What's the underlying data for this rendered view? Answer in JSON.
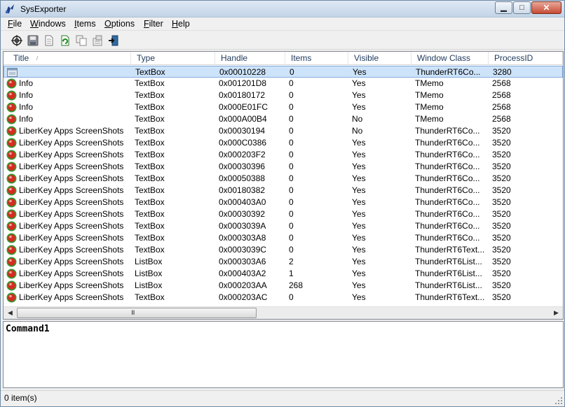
{
  "app": {
    "title": "SysExporter"
  },
  "caption": {
    "minimize": "▁",
    "maximize": "□",
    "close": "✕"
  },
  "menu": [
    {
      "label": "File",
      "u": "F",
      "rest": "ile"
    },
    {
      "label": "Windows",
      "u": "W",
      "rest": "indows"
    },
    {
      "label": "Items",
      "u": "I",
      "rest": "tems"
    },
    {
      "label": "Options",
      "u": "O",
      "rest": "ptions"
    },
    {
      "label": "Filter",
      "u": "F",
      "rest": "ilter"
    },
    {
      "label": "Help",
      "u": "H",
      "rest": "elp"
    }
  ],
  "toolbar": [
    "target-icon",
    "save-icon",
    "document-icon",
    "refresh-icon",
    "copy-icon",
    "properties-icon",
    "exit-icon"
  ],
  "table": {
    "columns": [
      "Title",
      "Type",
      "Handle",
      "Items",
      "Visible",
      "Window Class",
      "ProcessID"
    ],
    "rows": [
      [
        "",
        "TextBox",
        "0x00010228",
        "0",
        "Yes",
        "ThunderRT6Co...",
        "3280"
      ],
      [
        "Info",
        "TextBox",
        "0x001201D8",
        "0",
        "Yes",
        "TMemo",
        "2568"
      ],
      [
        "Info",
        "TextBox",
        "0x00180172",
        "0",
        "Yes",
        "TMemo",
        "2568"
      ],
      [
        "Info",
        "TextBox",
        "0x000E01FC",
        "0",
        "Yes",
        "TMemo",
        "2568"
      ],
      [
        "Info",
        "TextBox",
        "0x000A00B4",
        "0",
        "No",
        "TMemo",
        "2568"
      ],
      [
        "LiberKey Apps ScreenShots",
        "TextBox",
        "0x00030194",
        "0",
        "No",
        "ThunderRT6Co...",
        "3520"
      ],
      [
        "LiberKey Apps ScreenShots",
        "TextBox",
        "0x000C0386",
        "0",
        "Yes",
        "ThunderRT6Co...",
        "3520"
      ],
      [
        "LiberKey Apps ScreenShots",
        "TextBox",
        "0x000203F2",
        "0",
        "Yes",
        "ThunderRT6Co...",
        "3520"
      ],
      [
        "LiberKey Apps ScreenShots",
        "TextBox",
        "0x00030396",
        "0",
        "Yes",
        "ThunderRT6Co...",
        "3520"
      ],
      [
        "LiberKey Apps ScreenShots",
        "TextBox",
        "0x00050388",
        "0",
        "Yes",
        "ThunderRT6Co...",
        "3520"
      ],
      [
        "LiberKey Apps ScreenShots",
        "TextBox",
        "0x00180382",
        "0",
        "Yes",
        "ThunderRT6Co...",
        "3520"
      ],
      [
        "LiberKey Apps ScreenShots",
        "TextBox",
        "0x000403A0",
        "0",
        "Yes",
        "ThunderRT6Co...",
        "3520"
      ],
      [
        "LiberKey Apps ScreenShots",
        "TextBox",
        "0x00030392",
        "0",
        "Yes",
        "ThunderRT6Co...",
        "3520"
      ],
      [
        "LiberKey Apps ScreenShots",
        "TextBox",
        "0x0003039A",
        "0",
        "Yes",
        "ThunderRT6Co...",
        "3520"
      ],
      [
        "LiberKey Apps ScreenShots",
        "TextBox",
        "0x000303A8",
        "0",
        "Yes",
        "ThunderRT6Co...",
        "3520"
      ],
      [
        "LiberKey Apps ScreenShots",
        "TextBox",
        "0x0003039C",
        "0",
        "Yes",
        "ThunderRT6Text...",
        "3520"
      ],
      [
        "LiberKey Apps ScreenShots",
        "ListBox",
        "0x000303A6",
        "2",
        "Yes",
        "ThunderRT6List...",
        "3520"
      ],
      [
        "LiberKey Apps ScreenShots",
        "ListBox",
        "0x000403A2",
        "1",
        "Yes",
        "ThunderRT6List...",
        "3520"
      ],
      [
        "LiberKey Apps ScreenShots",
        "ListBox",
        "0x000203AA",
        "268",
        "Yes",
        "ThunderRT6List...",
        "3520"
      ],
      [
        "LiberKey Apps ScreenShots",
        "TextBox",
        "0x000203AC",
        "0",
        "Yes",
        "ThunderRT6Text...",
        "3520"
      ]
    ],
    "row_icons": [
      "window-icon",
      "red-window-icon"
    ],
    "selected_row": 0
  },
  "scrollbar": {
    "left_arrow": "◀",
    "right_arrow": "▶",
    "grip": "III"
  },
  "command": {
    "text": "Command1"
  },
  "status": {
    "text": "0 item(s)"
  },
  "colors": {
    "selection": "#cde3f9",
    "selection_border": "#84acdd",
    "title_bar": "#c3d4e7"
  }
}
